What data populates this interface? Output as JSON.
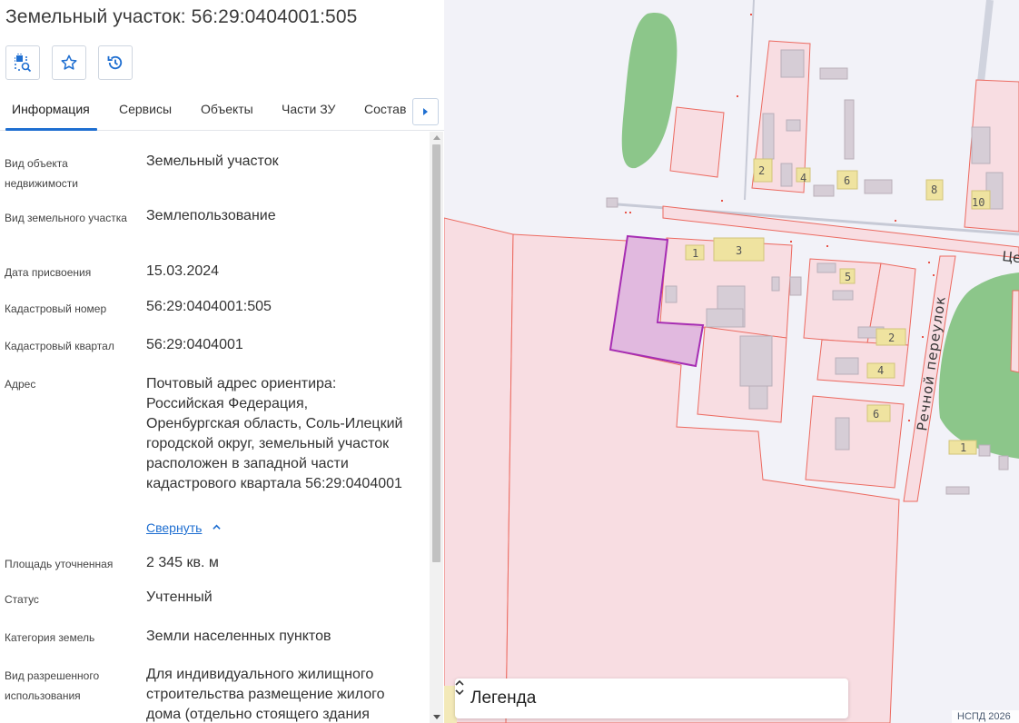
{
  "header": {
    "title": "Земельный участок: 56:29:0404001:505"
  },
  "toolbar": {
    "buttons": [
      {
        "name": "locate-on-map",
        "icon": "zoom-to-parcel-icon"
      },
      {
        "name": "favorite",
        "icon": "star-icon"
      },
      {
        "name": "history",
        "icon": "history-icon"
      }
    ],
    "accent_color": "#1f6fd1"
  },
  "tabs": [
    {
      "label": "Информация",
      "active": true
    },
    {
      "label": "Сервисы",
      "active": false
    },
    {
      "label": "Объекты",
      "active": false
    },
    {
      "label": "Части ЗУ",
      "active": false
    },
    {
      "label": "Состав",
      "active": false
    }
  ],
  "info": {
    "rows": [
      {
        "label": "Вид объекта недвижимости",
        "value": "Земельный участок"
      },
      {
        "label": "Вид земельного участка",
        "value": "Землепользование"
      },
      {
        "label": "Дата присвоения",
        "value": "15.03.2024"
      },
      {
        "label": "Кадастровый номер",
        "value": "56:29:0404001:505"
      },
      {
        "label": "Кадастровый квартал",
        "value": "56:29:0404001"
      },
      {
        "label": "Адрес",
        "value": "Почтовый адрес ориентира: Российская Федерация, Оренбургская область, Соль-Илецкий городской округ, земельный участок расположен в западной части кадастрового квартала 56:29:0404001"
      },
      {
        "label": "Площадь уточненная",
        "value": "2 345 кв. м"
      },
      {
        "label": "Статус",
        "value": "Учтенный"
      },
      {
        "label": "Категория земель",
        "value": "Земли населенных пунктов"
      },
      {
        "label": "Вид разрешенного использования",
        "value": "Для индивидуального жилищного строительства размещение жилого дома (отдельно стоящего здания"
      }
    ],
    "collapse_link": "Свернуть"
  },
  "map": {
    "street_label": "Речной переулок",
    "street_label_partial": "Це",
    "house_numbers": [
      "2",
      "4",
      "6",
      "8",
      "10",
      "1",
      "3",
      "5",
      "2",
      "4",
      "6",
      "1"
    ],
    "legend_label": "Легенда",
    "copyright": "НСПД 2026",
    "selected_parcel_color": "#a62db3",
    "parcel_border_color": "#e8554a"
  }
}
